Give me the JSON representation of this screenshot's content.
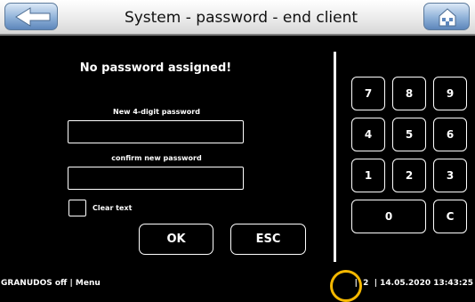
{
  "header": {
    "title": "System - password - end client",
    "back_icon": "back-arrow-icon",
    "home_icon": "home-icon"
  },
  "form": {
    "message": "No password assigned!",
    "new_password_label": "New 4-digit password",
    "new_password_value": "",
    "confirm_label": "confirm new password",
    "confirm_value": "",
    "clear_text_label": "Clear text",
    "clear_text_checked": false,
    "ok_label": "OK",
    "esc_label": "ESC"
  },
  "keypad": {
    "k7": "7",
    "k8": "8",
    "k9": "9",
    "k4": "4",
    "k5": "5",
    "k6": "6",
    "k1": "1",
    "k2": "2",
    "k3": "3",
    "k0": "0",
    "kc": "C"
  },
  "footer": {
    "left": "GRANUDOS off | Menu",
    "sep1": "|",
    "page": "2",
    "sep2": "|",
    "datetime": "14.05.2020 13:43:25"
  },
  "colors": {
    "highlight_ring": "#f5b800",
    "button_blue": "#8fb1d8"
  }
}
